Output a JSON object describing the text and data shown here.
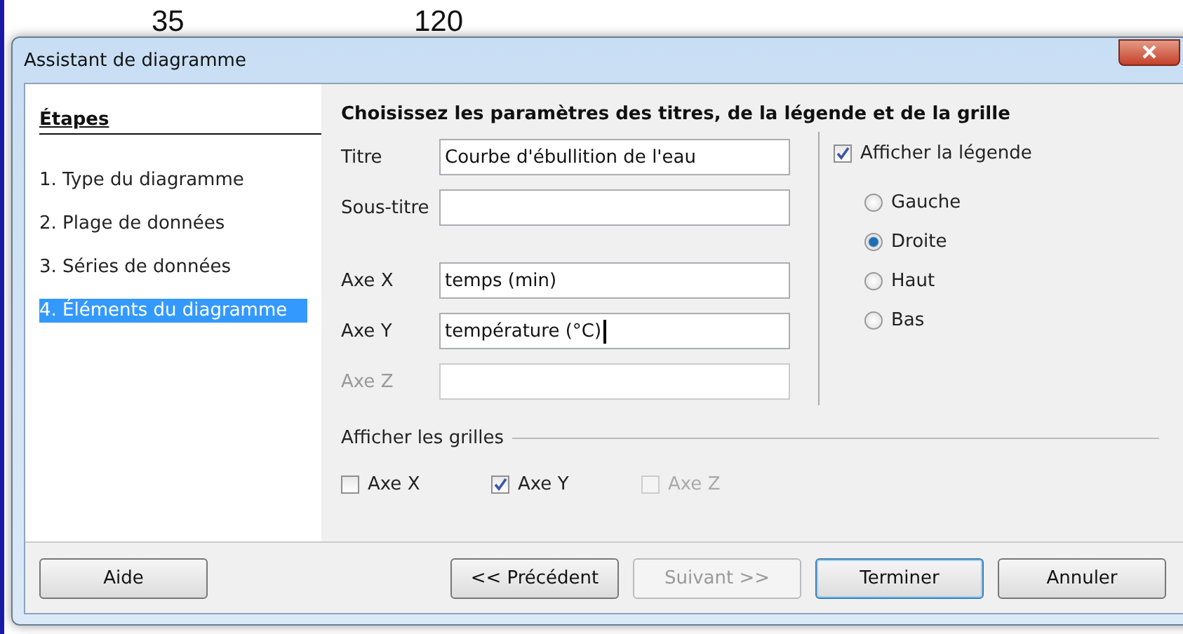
{
  "background": {
    "cells": [
      "35",
      "120"
    ]
  },
  "window": {
    "title": "Assistant de diagramme"
  },
  "steps": {
    "heading": "Étapes",
    "items": [
      {
        "label": "1. Type du diagramme",
        "selected": false
      },
      {
        "label": "2. Plage de données",
        "selected": false
      },
      {
        "label": "3. Séries de données",
        "selected": false
      },
      {
        "label": "4. Éléments du diagramme",
        "selected": true
      }
    ]
  },
  "heading": "Choisissez les paramètres des titres, de la légende et de la grille",
  "fields": [
    {
      "label": "Titre",
      "value": "Courbe d'ébullition de l'eau",
      "disabled": false
    },
    {
      "label": "Sous-titre",
      "disabled": false
    },
    {
      "label": "Axe X",
      "value": "temps (min)",
      "disabled": false
    },
    {
      "label": "Axe Y",
      "value": "température (°C)",
      "disabled": false,
      "focused": true
    },
    {
      "label": "Axe Z",
      "disabled": true
    }
  ],
  "legend": {
    "label": "Afficher la légende",
    "checked": true,
    "positions": [
      {
        "label": "Gauche",
        "selected": false
      },
      {
        "label": "Droite",
        "selected": true
      },
      {
        "label": "Haut",
        "selected": false
      },
      {
        "label": "Bas",
        "selected": false
      }
    ]
  },
  "grids": {
    "title": "Afficher les grilles",
    "items": [
      {
        "label": "Axe X",
        "checked": false,
        "disabled": false
      },
      {
        "label": "Axe Y",
        "checked": true,
        "disabled": false
      },
      {
        "label": "Axe Z",
        "checked": false,
        "disabled": true
      }
    ]
  },
  "buttons": [
    {
      "label": "Aide",
      "disabled": false,
      "default": false
    },
    {
      "label": "<< Précédent",
      "disabled": false,
      "default": false
    },
    {
      "label": "Suivant >>",
      "disabled": true,
      "default": false
    },
    {
      "label": "Terminer",
      "disabled": false,
      "default": true
    },
    {
      "label": "Annuler",
      "disabled": false,
      "default": false
    }
  ]
}
